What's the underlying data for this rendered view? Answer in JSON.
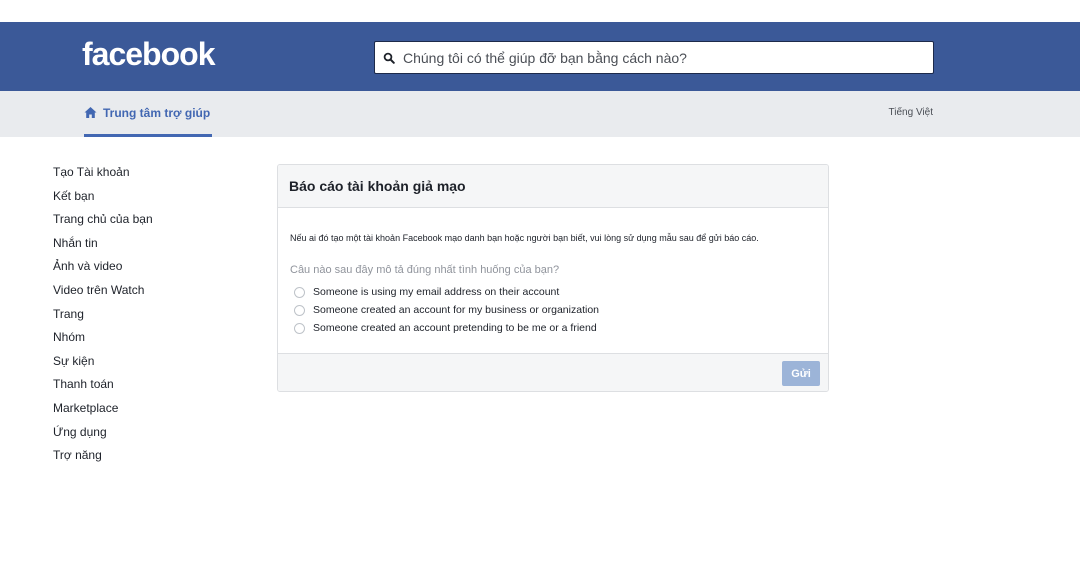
{
  "header": {
    "logo_text": "facebook",
    "search": {
      "placeholder": "Chúng tôi có thể giúp đỡ bạn bằng cách nào?"
    }
  },
  "subnav": {
    "help_center_label": "Trung tâm trợ giúp",
    "language_label": "Tiếng Việt"
  },
  "sidebar": {
    "items": [
      {
        "label": "Tạo Tài khoản"
      },
      {
        "label": "Kết bạn"
      },
      {
        "label": "Trang chủ của bạn"
      },
      {
        "label": "Nhắn tin"
      },
      {
        "label": "Ảnh và video"
      },
      {
        "label": "Video trên Watch"
      },
      {
        "label": "Trang"
      },
      {
        "label": "Nhóm"
      },
      {
        "label": "Sự kiện"
      },
      {
        "label": "Thanh toán"
      },
      {
        "label": "Marketplace"
      },
      {
        "label": "Ứng dụng"
      },
      {
        "label": "Trợ năng"
      }
    ]
  },
  "report_form": {
    "title": "Báo cáo tài khoản giả mạo",
    "intro": "Nếu ai đó tạo một tài khoản Facebook mạo danh bạn hoặc người bạn biết, vui lòng sử dụng mẫu sau để gửi báo cáo.",
    "question": "Câu nào sau đây mô tả đúng nhất tình huống của bạn?",
    "options": [
      {
        "label": "Someone is using my email address on their account"
      },
      {
        "label": "Someone created an account for my business or organization"
      },
      {
        "label": "Someone created an account pretending to be me or a friend"
      }
    ],
    "submit_label": "Gửi"
  },
  "colors": {
    "brand_blue": "#3b5998",
    "link_blue": "#4267b2",
    "subbar_bg": "#e9ebee",
    "disabled_button": "#9cb4d8"
  }
}
